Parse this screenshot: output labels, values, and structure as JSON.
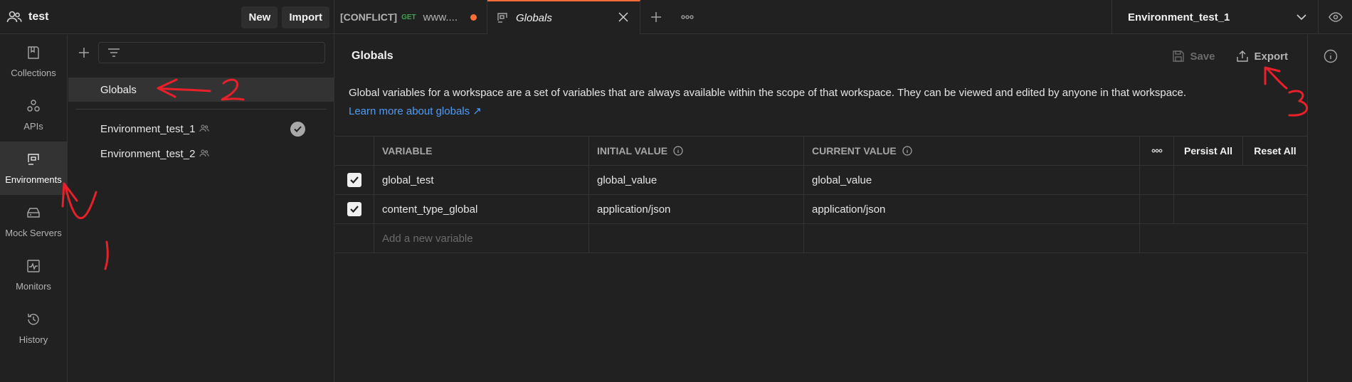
{
  "workspace": {
    "name": "test",
    "new_label": "New",
    "import_label": "Import"
  },
  "tabs": [
    {
      "prefix": "[CONFLICT]",
      "method": "GET",
      "title": "www...."
    },
    {
      "title": "Globals"
    }
  ],
  "environment_selector": {
    "value": "Environment_test_1"
  },
  "leftnav": [
    {
      "label": "Collections",
      "icon": "collections-icon"
    },
    {
      "label": "APIs",
      "icon": "apis-icon"
    },
    {
      "label": "Environments",
      "icon": "environments-icon",
      "active": true
    },
    {
      "label": "Mock Servers",
      "icon": "mock-servers-icon"
    },
    {
      "label": "Monitors",
      "icon": "monitors-icon"
    },
    {
      "label": "History",
      "icon": "history-icon"
    }
  ],
  "sidebar": {
    "globals_label": "Globals",
    "environments": [
      {
        "name": "Environment_test_1",
        "active": true
      },
      {
        "name": "Environment_test_2",
        "active": false
      }
    ]
  },
  "main": {
    "title": "Globals",
    "save_label": "Save",
    "export_label": "Export",
    "description": "Global variables for a workspace are a set of variables that are always available within the scope of that workspace. They can be viewed and edited by anyone in that workspace.",
    "learn_more": "Learn more about globals ↗",
    "table": {
      "headers": {
        "variable": "VARIABLE",
        "initial": "INITIAL VALUE",
        "current": "CURRENT VALUE",
        "persist_all": "Persist All",
        "reset_all": "Reset All"
      },
      "rows": [
        {
          "checked": true,
          "variable": "global_test",
          "initial": "global_value",
          "current": "global_value"
        },
        {
          "checked": true,
          "variable": "content_type_global",
          "initial": "application/json",
          "current": "application/json"
        }
      ],
      "add_placeholder": "Add a new variable"
    }
  },
  "colors": {
    "accent": "#ff6c37",
    "link": "#4f9cf5",
    "get_method": "#3fa34d",
    "annotation": "#e8202a"
  },
  "annotations": [
    "1",
    "2",
    "3"
  ]
}
